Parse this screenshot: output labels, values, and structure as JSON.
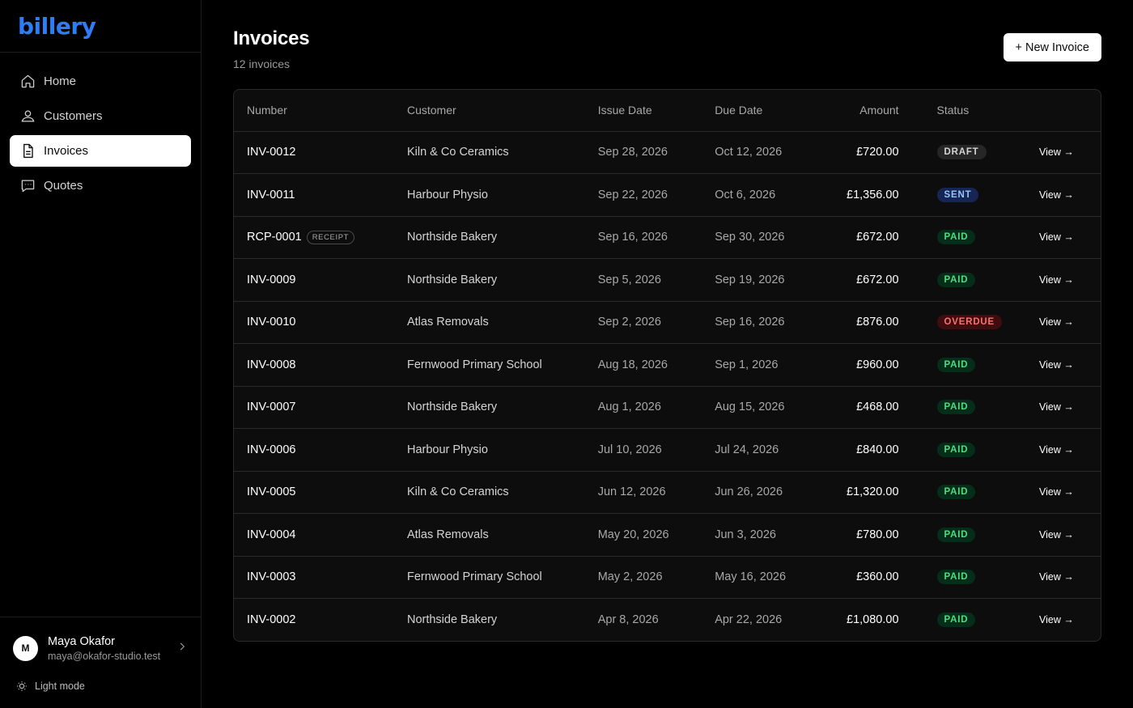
{
  "app": {
    "logo": "billery"
  },
  "sidebar": {
    "items": [
      {
        "label": "Home",
        "icon": "home-icon"
      },
      {
        "label": "Customers",
        "icon": "users-icon"
      },
      {
        "label": "Invoices",
        "icon": "document-icon",
        "active": true
      },
      {
        "label": "Quotes",
        "icon": "chat-icon"
      }
    ],
    "user": {
      "initial": "M",
      "name": "Maya Okafor",
      "email": "maya@okafor-studio.test"
    },
    "mode_label": "Light mode"
  },
  "page": {
    "title": "Invoices",
    "subtitle": "12 invoices",
    "new_button": "+ New Invoice"
  },
  "table": {
    "headers": {
      "number": "Number",
      "customer": "Customer",
      "issue": "Issue Date",
      "due": "Due Date",
      "amount": "Amount",
      "status": "Status"
    },
    "view_label": "View →",
    "rows": [
      {
        "number": "INV-0012",
        "customer": "Kiln & Co Ceramics",
        "issue": "Sep 28, 2026",
        "due": "Oct 12, 2026",
        "amount": "£720.00",
        "status": "DRAFT"
      },
      {
        "number": "INV-0011",
        "customer": "Harbour Physio",
        "issue": "Sep 22, 2026",
        "due": "Oct 6, 2026",
        "amount": "£1,356.00",
        "status": "SENT"
      },
      {
        "number": "RCP-0001",
        "tag": "RECEIPT",
        "customer": "Northside Bakery",
        "issue": "Sep 16, 2026",
        "due": "Sep 30, 2026",
        "amount": "£672.00",
        "status": "PAID"
      },
      {
        "number": "INV-0009",
        "customer": "Northside Bakery",
        "issue": "Sep 5, 2026",
        "due": "Sep 19, 2026",
        "amount": "£672.00",
        "status": "PAID"
      },
      {
        "number": "INV-0010",
        "customer": "Atlas Removals",
        "issue": "Sep 2, 2026",
        "due": "Sep 16, 2026",
        "amount": "£876.00",
        "status": "OVERDUE"
      },
      {
        "number": "INV-0008",
        "customer": "Fernwood Primary School",
        "issue": "Aug 18, 2026",
        "due": "Sep 1, 2026",
        "amount": "£960.00",
        "status": "PAID"
      },
      {
        "number": "INV-0007",
        "customer": "Northside Bakery",
        "issue": "Aug 1, 2026",
        "due": "Aug 15, 2026",
        "amount": "£468.00",
        "status": "PAID"
      },
      {
        "number": "INV-0006",
        "customer": "Harbour Physio",
        "issue": "Jul 10, 2026",
        "due": "Jul 24, 2026",
        "amount": "£840.00",
        "status": "PAID"
      },
      {
        "number": "INV-0005",
        "customer": "Kiln & Co Ceramics",
        "issue": "Jun 12, 2026",
        "due": "Jun 26, 2026",
        "amount": "£1,320.00",
        "status": "PAID"
      },
      {
        "number": "INV-0004",
        "customer": "Atlas Removals",
        "issue": "May 20, 2026",
        "due": "Jun 3, 2026",
        "amount": "£780.00",
        "status": "PAID"
      },
      {
        "number": "INV-0003",
        "customer": "Fernwood Primary School",
        "issue": "May 2, 2026",
        "due": "May 16, 2026",
        "amount": "£360.00",
        "status": "PAID"
      },
      {
        "number": "INV-0002",
        "customer": "Northside Bakery",
        "issue": "Apr 8, 2026",
        "due": "Apr 22, 2026",
        "amount": "£1,080.00",
        "status": "PAID"
      }
    ]
  },
  "colors": {
    "brand": "#2f7cf6",
    "status": {
      "DRAFT": {
        "bg": "#262626",
        "fg": "#d4d4d4"
      },
      "SENT": {
        "bg": "#172554",
        "fg": "#93c5fd"
      },
      "PAID": {
        "bg": "#052e1a",
        "fg": "#4ade80"
      },
      "OVERDUE": {
        "bg": "#3f0d0d",
        "fg": "#f87171"
      }
    }
  }
}
